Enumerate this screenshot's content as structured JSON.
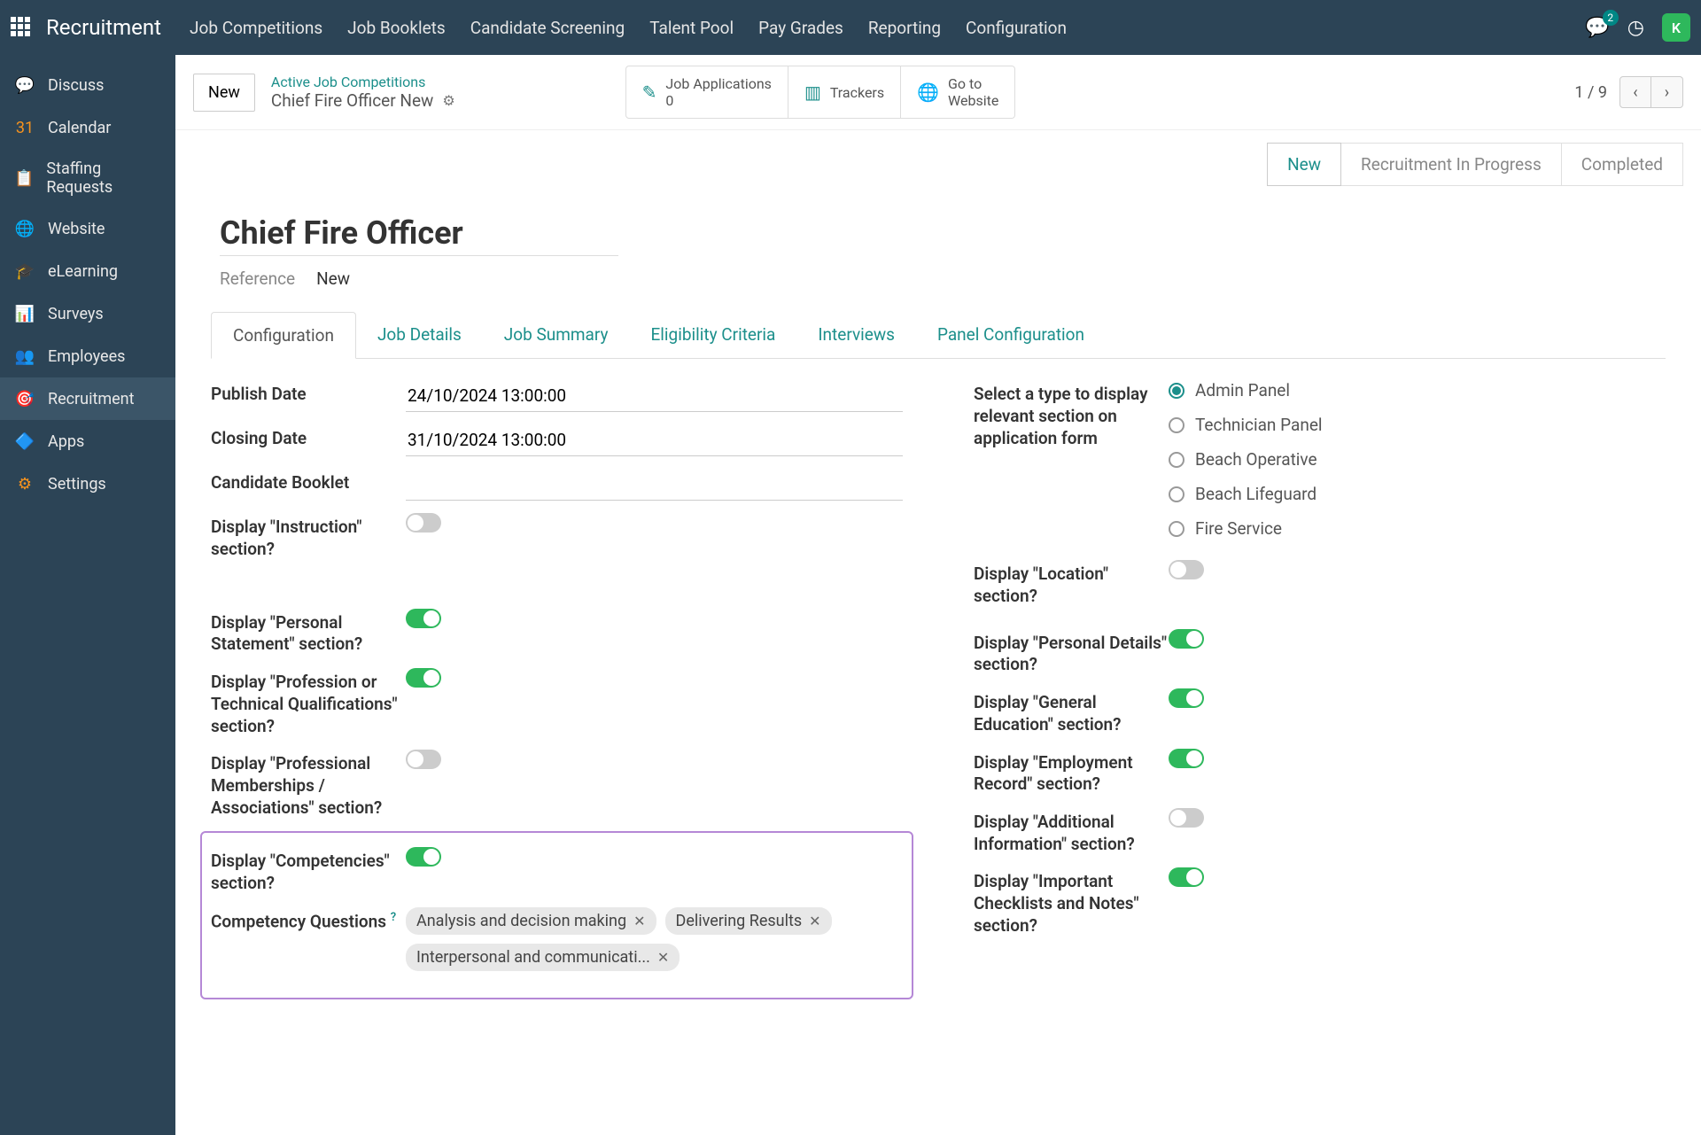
{
  "app_title": "Recruitment",
  "topnav": [
    "Job Competitions",
    "Job Booklets",
    "Candidate Screening",
    "Talent Pool",
    "Pay Grades",
    "Reporting",
    "Configuration"
  ],
  "chat_count": "2",
  "avatar_initial": "K",
  "sidebar": [
    {
      "label": "Discuss",
      "icon": "💬",
      "color": "#f7931e"
    },
    {
      "label": "Calendar",
      "icon": "31",
      "color": "#f7931e"
    },
    {
      "label": "Staffing Requests",
      "icon": "📋",
      "color": "#7bb8e8"
    },
    {
      "label": "Website",
      "icon": "🌐",
      "color": "#2eb85c"
    },
    {
      "label": "eLearning",
      "icon": "🎓",
      "color": "#1c8f8b"
    },
    {
      "label": "Surveys",
      "icon": "📊",
      "color": "#f7931e"
    },
    {
      "label": "Employees",
      "icon": "👥",
      "color": "#8bc34a"
    },
    {
      "label": "Recruitment",
      "icon": "🎯",
      "color": "#1c8f8b"
    },
    {
      "label": "Apps",
      "icon": "🔷",
      "color": "#e8432e"
    },
    {
      "label": "Settings",
      "icon": "⚙",
      "color": "#f7931e"
    }
  ],
  "sidebar_active_index": 7,
  "header": {
    "new_btn": "New",
    "breadcrumb_parent": "Active Job Competitions",
    "breadcrumb_current": "Chief Fire Officer New",
    "stats": [
      {
        "label": "Job Applications",
        "value": "0",
        "icon": "✎"
      },
      {
        "label": "Trackers",
        "icon": "📊"
      },
      {
        "label": "Go to",
        "value": "Website",
        "icon": "🌐"
      }
    ],
    "pager_text": "1 / 9"
  },
  "status_steps": [
    "New",
    "Recruitment In Progress",
    "Completed"
  ],
  "status_active": 0,
  "record": {
    "title": "Chief Fire Officer",
    "reference_label": "Reference",
    "reference_value": "New"
  },
  "tabs": [
    "Configuration",
    "Job Details",
    "Job Summary",
    "Eligibility Criteria",
    "Interviews",
    "Panel Configuration"
  ],
  "tabs_active": 0,
  "form": {
    "left": {
      "publish_date_label": "Publish Date",
      "publish_date_value": "24/10/2024 13:00:00",
      "closing_date_label": "Closing Date",
      "closing_date_value": "31/10/2024 13:00:00",
      "candidate_booklet_label": "Candidate Booklet",
      "candidate_booklet_value": "",
      "display_instruction_label": "Display \"Instruction\" section?",
      "display_instruction_on": false,
      "display_personal_statement_label": "Display \"Personal Statement\" section?",
      "display_personal_statement_on": true,
      "display_prof_qual_label": "Display \"Profession or Technical Qualifications\" section?",
      "display_prof_qual_on": true,
      "display_prof_member_label": "Display \"Professional Memberships / Associations\" section?",
      "display_prof_member_on": false,
      "display_competencies_label": "Display \"Competencies\" section?",
      "display_competencies_on": true,
      "competency_questions_label": "Competency Questions",
      "competency_tags": [
        "Analysis and decision making",
        "Delivering Results",
        "Interpersonal and communicati..."
      ]
    },
    "right": {
      "display_type_label": "Select a type to display relevant section on application form",
      "type_options": [
        "Admin Panel",
        "Technician Panel",
        "Beach Operative",
        "Beach Lifeguard",
        "Fire Service"
      ],
      "type_selected": 0,
      "display_location_label": "Display \"Location\" section?",
      "display_location_on": false,
      "display_personal_details_label": "Display \"Personal Details\" section?",
      "display_personal_details_on": true,
      "display_general_education_label": "Display \"General Education\" section?",
      "display_general_education_on": true,
      "display_employment_label": "Display \"Employment Record\" section?",
      "display_employment_on": true,
      "display_additional_label": "Display \"Additional Information\" section?",
      "display_additional_on": false,
      "display_checklists_label": "Display \"Important Checklists and Notes\" section?",
      "display_checklists_on": true
    }
  }
}
